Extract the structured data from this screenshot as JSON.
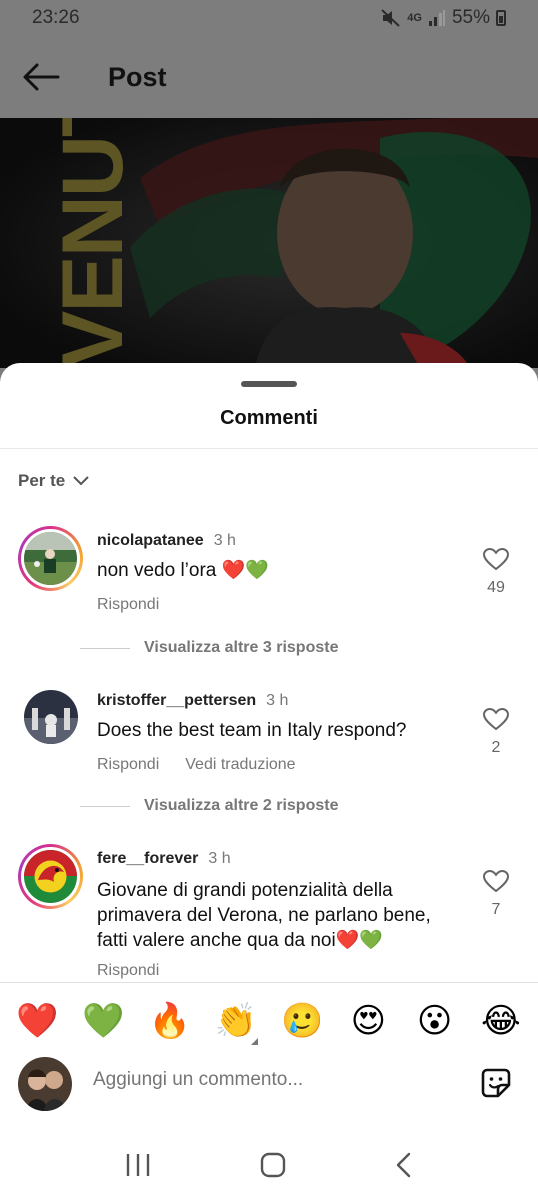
{
  "status_bar": {
    "time": "23:26",
    "network": "4G",
    "battery": "55%",
    "icons": [
      "mute-icon",
      "network-4g-icon",
      "signal-icon",
      "battery-icon"
    ]
  },
  "header": {
    "title": "Post",
    "back_icon": "back-arrow-icon"
  },
  "post_image": {
    "vertical_text": "VENUTO"
  },
  "sheet": {
    "title": "Commenti",
    "sort_label": "Per te"
  },
  "comments": [
    {
      "username": "nicolapatanee",
      "time": "3 h",
      "text": "non vedo l’ora",
      "emojis": "❤️💚",
      "reply_label": "Rispondi",
      "likes": "49",
      "more_replies": "Visualizza altre 3 risposte"
    },
    {
      "username": "kristoffer__pettersen",
      "time": "3 h",
      "text": "Does the best team in Italy respond?",
      "reply_label": "Rispondi",
      "translate_label": "Vedi traduzione",
      "likes": "2",
      "more_replies": "Visualizza altre 2 risposte"
    },
    {
      "username": "fere__forever",
      "time": "3 h",
      "text": "Giovane di grandi potenzialità della primavera del Verona, ne parlano bene, fatti valere anche qua da noi",
      "emojis": "❤️💚",
      "reply_label": "Rispondi",
      "likes": "7"
    }
  ],
  "emoji_bar": [
    "❤️",
    "💚",
    "🔥",
    "👏",
    "🥲",
    "😍",
    "😮",
    "😂"
  ],
  "composer": {
    "placeholder": "Aggiungi un commento..."
  },
  "colors": {
    "accent_red": "#ec3a63",
    "accent_green": "#2ecc71",
    "muted_text": "#777777"
  }
}
